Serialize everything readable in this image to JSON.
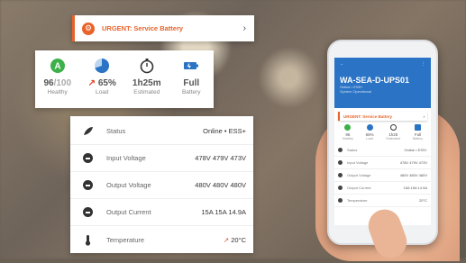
{
  "colors": {
    "accent": "#e8632a",
    "brand_blue": "#2a73c5",
    "healthy_green": "#3db04a"
  },
  "urgent": {
    "label": "URGENT: Service Battery",
    "icon": "gear-icon",
    "chevron": "›"
  },
  "stats": [
    {
      "icon": "healthy-icon",
      "value_main": "96",
      "value_dim": "/100",
      "label": "Healthy"
    },
    {
      "icon": "load-pie-icon",
      "value_main": "65%",
      "value_prefix": "↗",
      "label": "Load"
    },
    {
      "icon": "stopwatch-icon",
      "value_main": "1h25m",
      "label": "Estimated"
    },
    {
      "icon": "battery-icon",
      "value_main": "Full",
      "label": "Battery"
    }
  ],
  "details": [
    {
      "icon": "status-icon",
      "label": "Status",
      "value": "Online • ESS+"
    },
    {
      "icon": "input-voltage-icon",
      "label": "Input Voltage",
      "value": "478V 479V 473V"
    },
    {
      "icon": "output-voltage-icon",
      "label": "Output Voltage",
      "value": "480V 480V 480V"
    },
    {
      "icon": "output-current-icon",
      "label": "Output Current",
      "value": "15A 15A 14.9A"
    },
    {
      "icon": "thermometer-icon",
      "label": "Temperature",
      "value": "20°C",
      "value_prefix": "↗"
    }
  ],
  "phone": {
    "title": "WA-SEA-D-UPS01",
    "subtitle": "Online • ESS+",
    "subtitle2": "System Operational",
    "urgent": "URGENT: Service Battery",
    "stats": [
      {
        "value": "96",
        "label": "Healthy"
      },
      {
        "value": "65%",
        "label": "Load"
      },
      {
        "value": "1h25",
        "label": "Estimated"
      },
      {
        "value": "Full",
        "label": "Battery"
      }
    ],
    "rows": [
      {
        "label": "Status",
        "value": "Online • ESS+"
      },
      {
        "label": "Input Voltage",
        "value": "478V 479V 473V"
      },
      {
        "label": "Output Voltage",
        "value": "480V 480V 480V"
      },
      {
        "label": "Output Current",
        "value": "15A 15A 14.9A"
      },
      {
        "label": "Temperature",
        "value": "20°C"
      }
    ]
  }
}
